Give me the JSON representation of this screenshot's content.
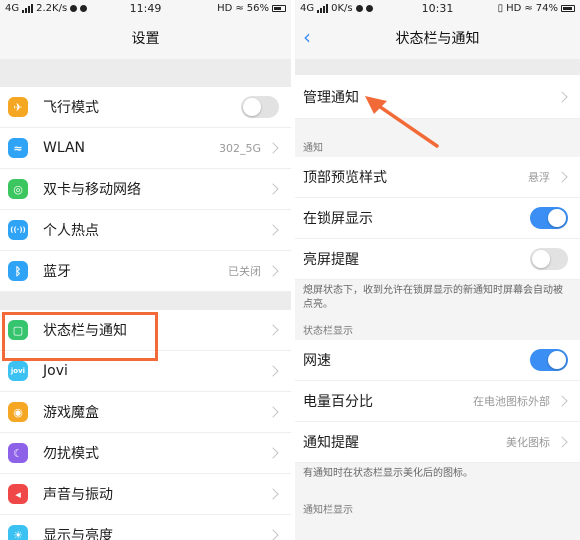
{
  "left": {
    "status": {
      "network": "4G",
      "speed": "2.2K/s",
      "time": "11:49",
      "hd": "HD",
      "battery": "56%"
    },
    "title": "设置",
    "items": [
      {
        "label": "飞行模式",
        "icon": "airplane-icon",
        "color": "#f5a623",
        "glyph": "✈",
        "toggle": "off"
      },
      {
        "label": "WLAN",
        "icon": "wifi-icon",
        "color": "#2fa3f6",
        "glyph": "≈",
        "value": "302_5G"
      },
      {
        "label": "双卡与移动网络",
        "icon": "globe-icon",
        "color": "#3cc65f",
        "glyph": "◎"
      },
      {
        "label": "个人热点",
        "icon": "hotspot-icon",
        "color": "#2fa3f6",
        "glyph": "((·))"
      },
      {
        "label": "蓝牙",
        "icon": "bluetooth-icon",
        "color": "#2fa3f6",
        "glyph": "ᛒ",
        "value": "已关闭"
      },
      {
        "label": "状态栏与通知",
        "icon": "notification-icon",
        "color": "#36c46f",
        "glyph": "▢"
      },
      {
        "label": "Jovi",
        "icon": "jovi-icon",
        "color": "#3cc2f2",
        "glyph": "jovi"
      },
      {
        "label": "游戏魔盒",
        "icon": "game-box-icon",
        "color": "#f5a623",
        "glyph": "◉"
      },
      {
        "label": "勿扰模式",
        "icon": "moon-icon",
        "color": "#8d62e8",
        "glyph": "☾"
      },
      {
        "label": "声音与振动",
        "icon": "speaker-icon",
        "color": "#f04848",
        "glyph": "◂"
      },
      {
        "label": "显示与亮度",
        "icon": "brightness-icon",
        "color": "#3cc2f2",
        "glyph": "☀"
      }
    ]
  },
  "right": {
    "status": {
      "network": "4G",
      "speed": "0K/s",
      "time": "10:31",
      "hd": "HD",
      "battery": "74%"
    },
    "title": "状态栏与通知",
    "manage": "管理通知",
    "section1": "通知",
    "top_preview": {
      "label": "顶部预览样式",
      "value": "悬浮"
    },
    "lockscreen": {
      "label": "在锁屏显示",
      "toggle": "on"
    },
    "wake": {
      "label": "亮屏提醒",
      "toggle": "off"
    },
    "wake_note": "熄屏状态下，收到允许在锁屏显示的新通知时屏幕会自动被点亮。",
    "section2": "状态栏显示",
    "net_speed": {
      "label": "网速",
      "toggle": "on"
    },
    "battery_pct": {
      "label": "电量百分比",
      "value": "在电池图标外部"
    },
    "notif_reminder": {
      "label": "通知提醒",
      "value": "美化图标"
    },
    "reminder_note": "有通知时在状态栏显示美化后的图标。",
    "section3": "通知栏显示"
  },
  "annotation_color": "#f26a38",
  "accent": "#3b8ef3"
}
